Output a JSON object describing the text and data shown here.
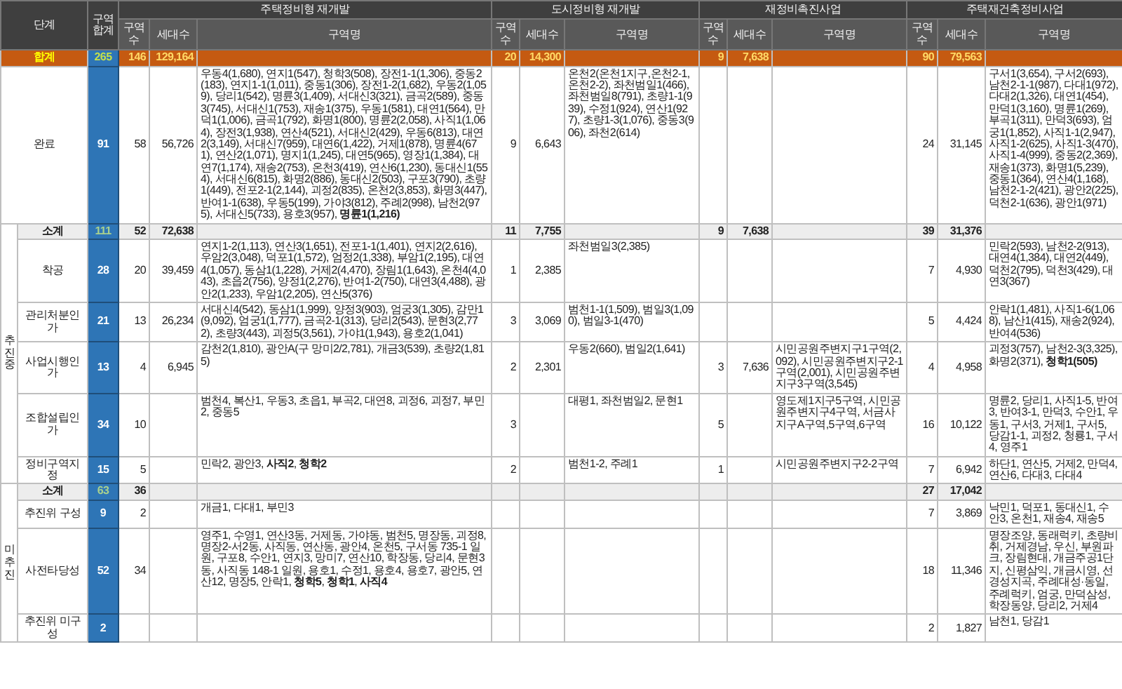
{
  "table": {
    "columns": {
      "stage": "단계",
      "total": "구역 합계",
      "groups": [
        {
          "title": "주택정비형 재개발",
          "count": "구역수",
          "households": "세대수",
          "names": "구역명"
        },
        {
          "title": "도시정비형 재개발",
          "count": "구역수",
          "households": "세대수",
          "names": "구역명"
        },
        {
          "title": "재정비촉진사업",
          "count": "구역수",
          "households": "세대수",
          "names": "구역명"
        },
        {
          "title": "주택재건축정비사업",
          "count": "구역수",
          "households": "세대수",
          "names": "구역명"
        }
      ]
    },
    "total_row": {
      "label": "합계",
      "total": "265",
      "cells": [
        {
          "count": "146",
          "households": "129,164"
        },
        {
          "count": "20",
          "households": "14,300"
        },
        {
          "count": "9",
          "households": "7,638"
        },
        {
          "count": "90",
          "households": "79,563"
        }
      ]
    },
    "sections": [
      {
        "kind": "single",
        "rows": [
          {
            "stage": "완료",
            "total": "91",
            "cells": [
              {
                "count": "58",
                "households": "56,726",
                "names": "우동4(1,680), 연지1(547), 청학3(508), 장전1-1(1,306), 중동2(183), 연지1-1(1,011), 중동1(306), 장전1-2(1,682), 우동2(1,059), 당리1(542), 명륜3(1,409), 서대신3(321), 금곡2(589), 중동3(745), 서대신1(753), 재송1(375), 우동1(581), 대연1(564), 만덕1(1,006), 금곡1(792), 화명1(800), 명륜2(2,058), 사직1(1,064), 장전3(1,938), 연산4(521), 서대신2(429), 우동6(813), 대연2(3,149), 서대신7(959), 대연6(1,422), 거제1(878), 명륜4(671), 연산2(1,071), 명지1(1,245), 대연5(965), 영장1(1,384), 대연7(1,174), 재송2(753), 온천3(419), 연산6(1,230), 동대신1(554), 서대신6(815), 화명2(886), 동대신2(503), 구포3(790), 초량1(449), 전포2-1(2,144), 괴정2(835), 온천2(3,853), 화명3(447), 반여1-1(638), 우동5(199), 가야3(812), 주례2(998), 남천2(975), 서대신5(733), 용호3(957), **명륜1(1,216)**"
              },
              {
                "count": "9",
                "households": "6,643",
                "names": "온천2(온천1지구,온천2-1,온천2-2), 좌천범일1(466), 좌천범일8(791), 초량1-1(939), 수정1(924), 연산1(927), 초량1-3(1,076), 중동3(906), 좌천2(614)"
              },
              {},
              {
                "count": "24",
                "households": "31,145",
                "names": "구서1(3,654), 구서2(693), 남천2-1-1(987), 다대1(972), 다대2(1,326), 대연1(454), 만덕1(3,160), 명륜1(269), 부곡1(311), 만덕3(693), 엄궁1(1,852), 사직1-1(2,947), 사직1-2(625), 사직1-3(470), 사직1-4(999), 중동2(2,369), 재송1(373), 화명1(5,239), 중동1(364), 연산4(1,168), 남천2-1-2(421), 광안2(225), 덕천2-1(636), 광안1(971)"
              }
            ]
          }
        ]
      },
      {
        "kind": "group",
        "label": "추진중",
        "subtotal": {
          "label": "소계",
          "total": "111",
          "cells": [
            {
              "count": "52",
              "households": "72,638"
            },
            {
              "count": "11",
              "households": "7,755"
            },
            {
              "count": "9",
              "households": "7,638"
            },
            {
              "count": "39",
              "households": "31,376"
            }
          ]
        },
        "rows": [
          {
            "stage": "착공",
            "total": "28",
            "cells": [
              {
                "count": "20",
                "households": "39,459",
                "names": "연지1-2(1,113), 연산3(1,651), 전포1-1(1,401), 연지2(2,616), 우암2(3,048), 덕포1(1,572), 엄정2(1,338), 부암1(2,195), 대연4(1,057), 동삼1(1,228), 거제2(4,470), 장림1(1,643), 온천4(4,043), 초읍2(756), 양정1(2,276), 반여1-2(750), 대연3(4,488), 광안2(1,233), 우암1(2,205), 연산5(376)"
              },
              {
                "count": "1",
                "households": "2,385",
                "names": "좌천범일3(2,385)"
              },
              {},
              {
                "count": "7",
                "households": "4,930",
                "names": "민락2(593), 남천2-2(913), 대연4(1,384), 대연2(449), 덕천2(795), 덕천3(429), 대연3(367)"
              }
            ]
          },
          {
            "stage": "관리처분인가",
            "total": "21",
            "cells": [
              {
                "count": "13",
                "households": "26,234",
                "names": "서대신4(542), 동삼1(1,999), 양정3(903), 엄궁3(1,305), 감만1(9,092), 엄궁1(1,777), 금곡2-1(313), 당리2(543), 문현3(2,772), 초량3(443), 괴정5(3,561), 가야1(1,943), 용호2(1,041)"
              },
              {
                "count": "3",
                "households": "3,069",
                "names": "범천1-1(1,509), 범일3(1,090), 범일3-1(470)"
              },
              {},
              {
                "count": "5",
                "households": "4,424",
                "names": "안락1(1,481), 사직1-6(1,068), 남산1(415), 재송2(924), 반여4(536)"
              }
            ]
          },
          {
            "stage": "사업시행인가",
            "total": "13",
            "cells": [
              {
                "count": "4",
                "households": "6,945",
                "names": "감천2(1,810), 광안A(구 망미2/2,781), 개금3(539), 초량2(1,815)"
              },
              {
                "count": "2",
                "households": "2,301",
                "names": "우동2(660), 범일2(1,641)"
              },
              {
                "count": "3",
                "households": "7,636",
                "names": "시민공원주변지구1구역(2,092), 시민공원주변지구2-1구역(2,001), 시민공원주변지구3구역(3,545)"
              },
              {
                "count": "4",
                "households": "4,958",
                "names": "괴정3(757), 남천2-3(3,325), 화명2(371), **청학1(505)**"
              }
            ]
          },
          {
            "stage": "조합설립인가",
            "total": "34",
            "cells": [
              {
                "count": "10",
                "names": "범천4, 복산1, 우동3, 초읍1, 부곡2, 대연8, 괴정6, 괴정7, 부민2, 중동5"
              },
              {
                "count": "3",
                "names": "대평1, 좌천범일2, 문현1"
              },
              {
                "count": "5",
                "names": "영도제1지구5구역, 시민공원주변지구4구역, 서금사지구A구역,5구역,6구역"
              },
              {
                "count": "16",
                "households": "10,122",
                "names": "명륜2, 당리1, 사직1-5, 반여3, 반여3-1, 만덕3, 수안1, 우동1, 구서3, 거제1, 구서5, 당감1-1, 괴정2, 청룡1, 구서4, 영주1"
              }
            ]
          },
          {
            "stage": "정비구역지정",
            "total": "15",
            "cells": [
              {
                "count": "5",
                "names": "민락2, 광안3, **사직2**, **청학2**"
              },
              {
                "count": "2",
                "names": "범천1-2, 주례1"
              },
              {
                "count": "1",
                "names": "시민공원주변지구2-2구역"
              },
              {
                "count": "7",
                "households": "6,942",
                "names": "하단1, 연산5, 거제2, 만덕4, 연산6, 다대3, 다대4"
              }
            ]
          }
        ]
      },
      {
        "kind": "group",
        "label": "미추진",
        "subtotal": {
          "label": "소계",
          "total": "63",
          "cells": [
            {
              "count": "36"
            },
            {},
            {},
            {
              "count": "27",
              "households": "17,042"
            }
          ]
        },
        "rows": [
          {
            "stage": "추진위 구성",
            "total": "9",
            "cells": [
              {
                "count": "2",
                "names": "개금1, 다대1, 부민3"
              },
              {},
              {},
              {
                "count": "7",
                "households": "3,869",
                "names": "낙민1, 덕포1, 동대신1, 수안3, 온천1, 재송4, 재송5"
              }
            ]
          },
          {
            "stage": "사전타당성",
            "total": "52",
            "cells": [
              {
                "count": "34",
                "names": "영주1, 수영1, 연산3동, 거제동, 가야동, 범천5, 명장동, 괴정8, 명장2-서2동, 사직동, 연산동, 광안4, 온천5, 구서동 735-1 일원, 구포8, 수안1, 연지3, 망미7, 연산10, 학장동, 당리4, 문현3동, 사직동 148-1 일원, 용호1, 수정1, 용호4, 용호7, 광안5, 연산12, 명장5, 안락1, **청학5**, **청학1**, **사직4**"
              },
              {},
              {},
              {
                "count": "18",
                "households": "11,346",
                "names": "명장조양, 동래럭키, 초량비취, 거제경남, 우신, 부원파크, 장림현대, 개금주공1단지, 신평삼익, 개금시영, 선경성지곡, 주례대성·동일, 주례럭키, 엄궁, 만덕삼성, 학장동양, 당리2, 거제4"
              }
            ]
          },
          {
            "stage": "추진위 미구성",
            "total": "2",
            "cells": [
              {},
              {},
              {},
              {
                "count": "2",
                "households": "1,827",
                "names": "남천1, 당감1"
              }
            ]
          }
        ]
      }
    ]
  }
}
